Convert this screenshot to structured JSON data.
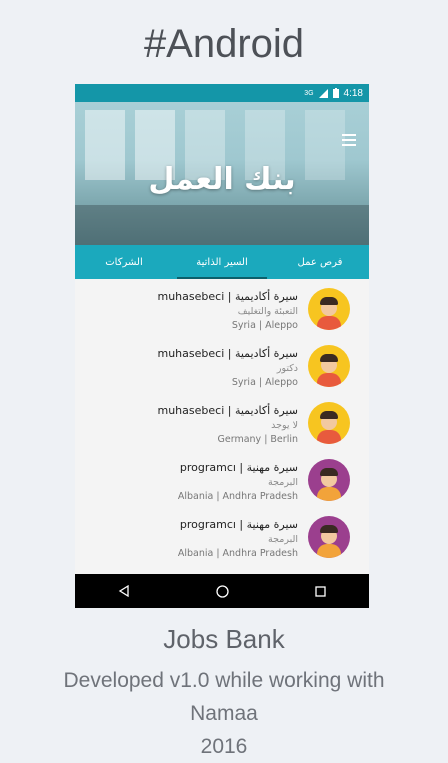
{
  "page": {
    "heading": "#Android",
    "footer_title": "Jobs Bank",
    "footer_line1": "Developed v1.0 while working with",
    "footer_line2": "Namaa",
    "footer_line3": "2016"
  },
  "phone": {
    "status": {
      "network": "3G",
      "time": "4:18"
    },
    "hero_title": "بنك العمل",
    "tabs": [
      {
        "label": "الشركات",
        "active": false
      },
      {
        "label": "السير الذاتية",
        "active": true
      },
      {
        "label": "فرص عمل",
        "active": false
      }
    ],
    "items": [
      {
        "title": "muhasebeci | سيرة أكاديمية",
        "subtitle": "التعبئة والتغليف",
        "location": "Syria | Aleppo",
        "avatar_color": "#f7c520",
        "shirt_color": "#e85a3d"
      },
      {
        "title": "muhasebeci | سيرة أكاديمية",
        "subtitle": "دكتور",
        "location": "Syria | Aleppo",
        "avatar_color": "#f7c520",
        "shirt_color": "#e85a3d"
      },
      {
        "title": "muhasebeci | سيرة أكاديمية",
        "subtitle": "لا يوجد",
        "location": "Germany | Berlin",
        "avatar_color": "#f7c520",
        "shirt_color": "#e85a3d"
      },
      {
        "title": "programcı | سيرة مهنية",
        "subtitle": "البرمجة",
        "location": "Albania | Andhra Pradesh",
        "avatar_color": "#9b3f8e",
        "shirt_color": "#f2a33a"
      },
      {
        "title": "programcı | سيرة مهنية",
        "subtitle": "البرمجة",
        "location": "Albania | Andhra Pradesh",
        "avatar_color": "#9b3f8e",
        "shirt_color": "#f2a33a"
      }
    ],
    "nav": {
      "back": "back-icon",
      "home": "home-icon",
      "recents": "recents-icon"
    }
  }
}
